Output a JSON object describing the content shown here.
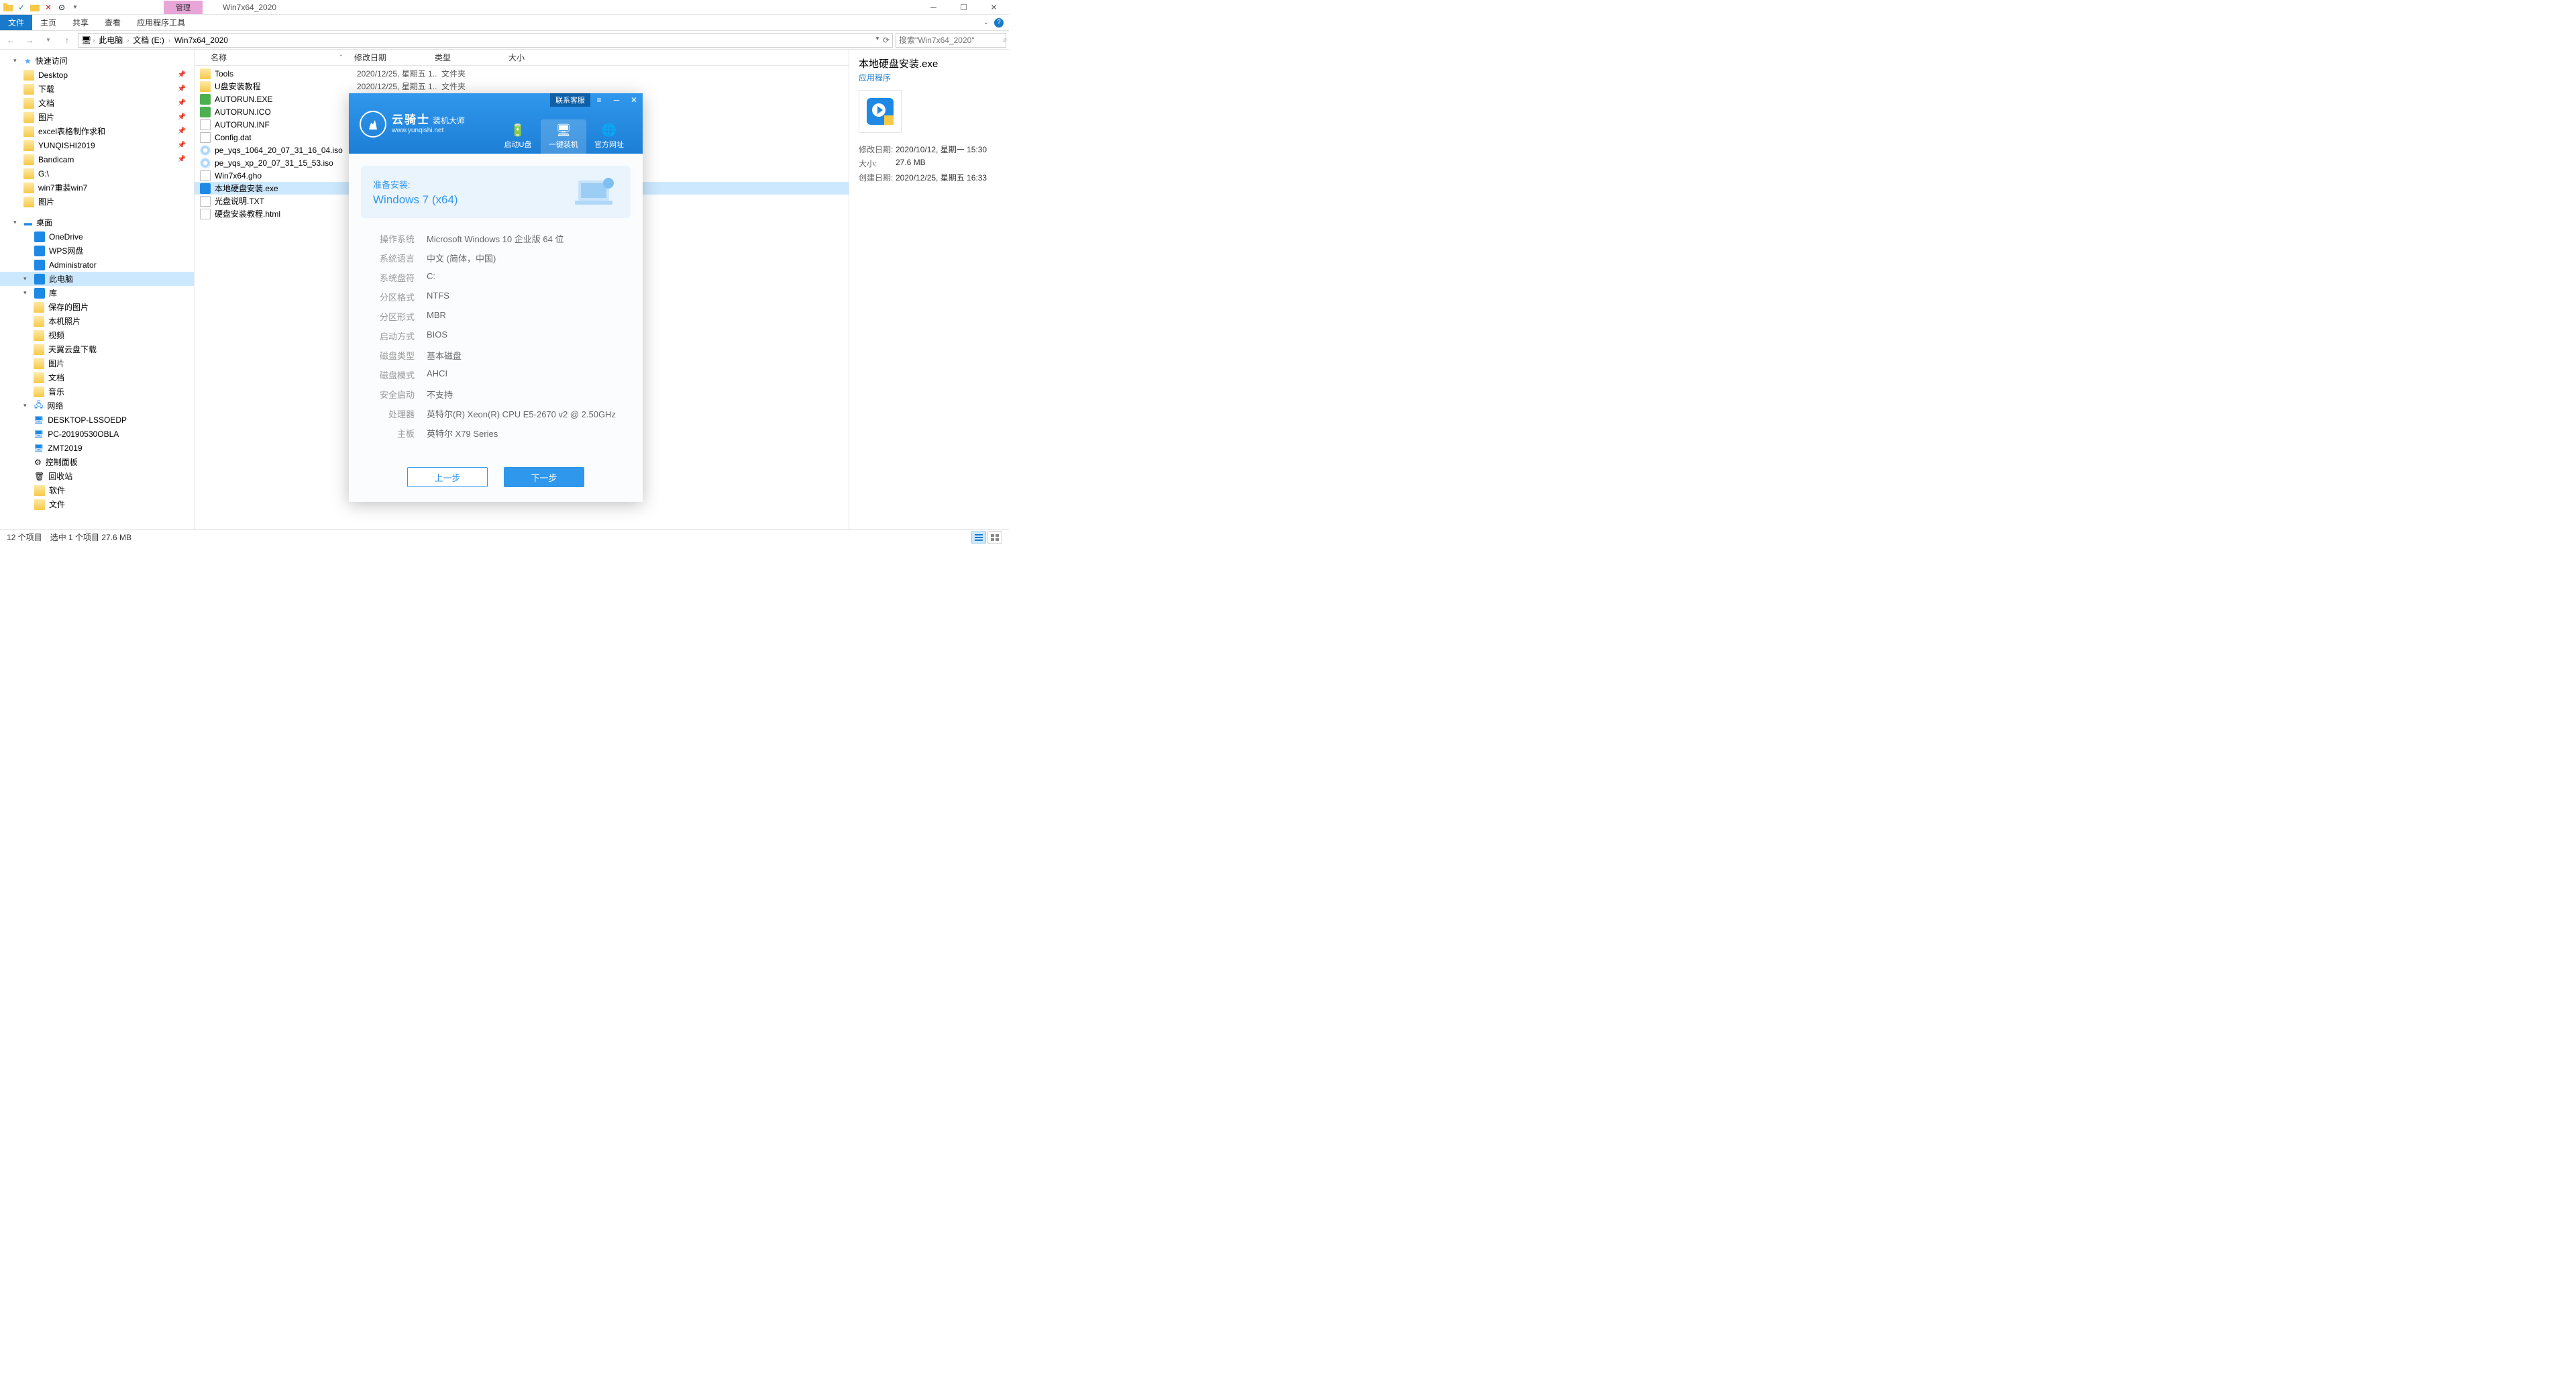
{
  "window": {
    "title": "Win7x64_2020",
    "contextual": "管理"
  },
  "ribbon": {
    "file": "文件",
    "tabs": [
      "主页",
      "共享",
      "查看",
      "应用程序工具"
    ]
  },
  "breadcrumb": [
    "此电脑",
    "文档 (E:)",
    "Win7x64_2020"
  ],
  "search": {
    "placeholder": "搜索\"Win7x64_2020\""
  },
  "columns": {
    "name": "名称",
    "date": "修改日期",
    "type": "类型",
    "size": "大小"
  },
  "tree": {
    "quick": "快速访问",
    "quick_items": [
      "Desktop",
      "下载",
      "文档",
      "图片",
      "excel表格制作求和",
      "YUNQISHI2019",
      "Bandicam",
      "G:\\",
      "win7重装win7",
      "图片"
    ],
    "desktop": "桌面",
    "desktop_items": [
      "OneDrive",
      "WPS网盘",
      "Administrator",
      "此电脑",
      "库"
    ],
    "lib_items": [
      "保存的图片",
      "本机照片",
      "视频",
      "天翼云盘下载",
      "图片",
      "文档",
      "音乐"
    ],
    "network": "网络",
    "net_items": [
      "DESKTOP-LSSOEDP",
      "PC-20190530OBLA",
      "ZMT2019"
    ],
    "cp": "控制面板",
    "recycle": "回收站",
    "software": "软件",
    "files": "文件"
  },
  "files": [
    {
      "name": "Tools",
      "date": "2020/12/25, 星期五 1...",
      "type": "文件夹",
      "icon": "folder"
    },
    {
      "name": "U盘安装教程",
      "date": "2020/12/25, 星期五 1...",
      "type": "文件夹",
      "icon": "folder"
    },
    {
      "name": "AUTORUN.EXE",
      "date": "",
      "type": "",
      "icon": "green"
    },
    {
      "name": "AUTORUN.ICO",
      "date": "",
      "type": "",
      "icon": "green"
    },
    {
      "name": "AUTORUN.INF",
      "date": "",
      "type": "",
      "icon": "file"
    },
    {
      "name": "Config.dat",
      "date": "",
      "type": "",
      "icon": "file"
    },
    {
      "name": "pe_yqs_1064_20_07_31_16_04.iso",
      "date": "",
      "type": "",
      "icon": "disc"
    },
    {
      "name": "pe_yqs_xp_20_07_31_15_53.iso",
      "date": "",
      "type": "",
      "icon": "disc"
    },
    {
      "name": "Win7x64.gho",
      "date": "",
      "type": "",
      "icon": "file"
    },
    {
      "name": "本地硬盘安装.exe",
      "date": "",
      "type": "",
      "icon": "blue",
      "selected": true
    },
    {
      "name": "光盘说明.TXT",
      "date": "",
      "type": "",
      "icon": "file"
    },
    {
      "name": "硬盘安装教程.html",
      "date": "",
      "type": "",
      "icon": "file"
    }
  ],
  "details": {
    "title": "本地硬盘安装.exe",
    "subtitle": "应用程序",
    "rows": [
      {
        "label": "修改日期:",
        "value": "2020/10/12, 星期一 15:30"
      },
      {
        "label": "大小:",
        "value": "27.6 MB"
      },
      {
        "label": "创建日期:",
        "value": "2020/12/25, 星期五 16:33"
      }
    ]
  },
  "status": {
    "count": "12 个项目",
    "selected": "选中 1 个项目  27.6 MB"
  },
  "installer": {
    "contact": "联系客服",
    "brand": "云骑士",
    "brand_suffix": "装机大师",
    "url": "www.yunqishi.net",
    "tabs": [
      {
        "label": "启动U盘"
      },
      {
        "label": "一键装机",
        "active": true
      },
      {
        "label": "官方网址"
      }
    ],
    "prepare_label": "准备安装:",
    "prepare_os": "Windows 7 (x64)",
    "specs": [
      {
        "label": "操作系统",
        "value": "Microsoft Windows 10 企业版 64 位"
      },
      {
        "label": "系统语言",
        "value": "中文 (简体，中国)"
      },
      {
        "label": "系统盘符",
        "value": "C:"
      },
      {
        "label": "分区格式",
        "value": "NTFS"
      },
      {
        "label": "分区形式",
        "value": "MBR"
      },
      {
        "label": "启动方式",
        "value": "BIOS"
      },
      {
        "label": "磁盘类型",
        "value": "基本磁盘"
      },
      {
        "label": "磁盘模式",
        "value": "AHCI"
      },
      {
        "label": "安全启动",
        "value": "不支持"
      },
      {
        "label": "处理器",
        "value": "英特尔(R) Xeon(R) CPU E5-2670 v2 @ 2.50GHz"
      },
      {
        "label": "主板",
        "value": "英特尔 X79 Series"
      }
    ],
    "prev": "上一步",
    "next": "下一步"
  }
}
